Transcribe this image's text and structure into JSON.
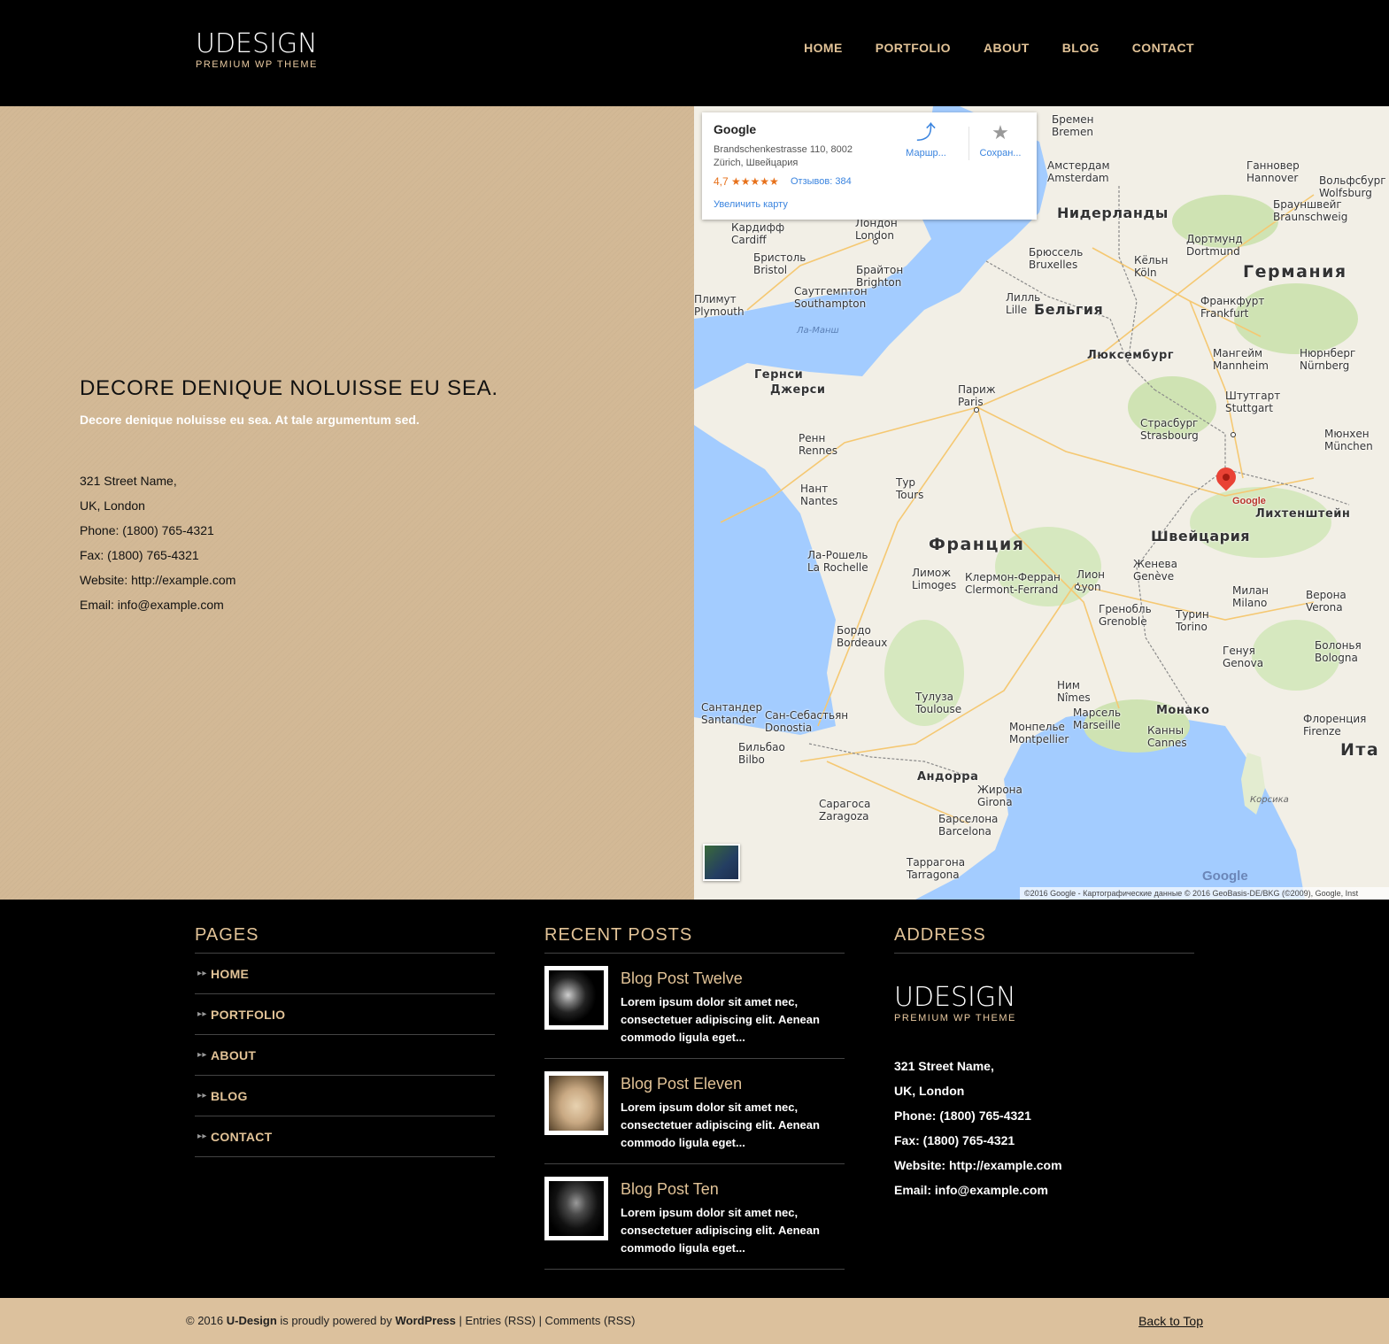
{
  "header": {
    "logo_main": "UDESIGN",
    "logo_sub": "PREMIUM WP THEME",
    "nav": [
      "HOME",
      "PORTFOLIO",
      "ABOUT",
      "BLOG",
      "CONTACT"
    ]
  },
  "contact": {
    "heading": "DECORE DENIQUE NOLUISSE EU SEA.",
    "tagline": "Decore denique noluisse eu sea. At tale argumentum sed.",
    "lines": [
      "321 Street Name,",
      "UK, London",
      "Phone: (1800) 765-4321",
      "Fax: (1800) 765-4321",
      "Website: http://example.com",
      "Email: info@example.com"
    ]
  },
  "map": {
    "card_title": "Google",
    "card_address_1": "Brandschenkestrasse 110, 8002",
    "card_address_2": "Zürich, Швейцария",
    "rating": "4,7 ★★★★★",
    "reviews": "Отзывов: 384",
    "enlarge": "Увеличить карту",
    "directions": "Маршр...",
    "save": "Сохран...",
    "pin_label": "Google",
    "google_logo": "Google",
    "copyright": "©2016 Google - Картографические данные © 2016 GeoBasis-DE/BKG (©2009), Google, Inst",
    "countries": [
      "Германия",
      "Франция",
      "Швейцария",
      "Бельгия",
      "Нидерланды",
      "Ита"
    ],
    "cities": [
      [
        "Бремен",
        "Bremen"
      ],
      [
        "Амстердам",
        "Amsterdam"
      ],
      [
        "Ганновер",
        "Hannover"
      ],
      [
        "Лондон",
        "London"
      ],
      [
        "Кардифф",
        "Cardiff"
      ],
      [
        "Бристоль",
        "Bristol"
      ],
      [
        "Брайтон",
        "Brighton"
      ],
      [
        "Саутгемптон",
        "Southampton"
      ],
      [
        "Плимут",
        "Plymouth"
      ],
      [
        "Брюссель",
        "Bruxelles"
      ],
      [
        "Кёльн",
        "Köln"
      ],
      [
        "Дортмунд",
        "Dortmund"
      ],
      [
        "Лилль",
        "Lille"
      ],
      [
        "Франкфурт",
        "Frankfurt"
      ],
      [
        "Мангейм",
        "Mannheim"
      ],
      [
        "Нюрнберг",
        "Nürnberg"
      ],
      [
        "Париж",
        "Paris"
      ],
      [
        "Штутгарт",
        "Stuttgart"
      ],
      [
        "Страсбург",
        "Strasbourg"
      ],
      [
        "Мюнхен",
        "München"
      ],
      [
        "Ренн",
        "Rennes"
      ],
      [
        "Тур",
        "Tours"
      ],
      [
        "Нант",
        "Nantes"
      ],
      [
        "Ла-Рошель",
        "La Rochelle"
      ],
      [
        "Лимож",
        "Limoges"
      ],
      [
        "Клермон-Ферран",
        "Clermont-Ferrand"
      ],
      [
        "Лион",
        "Lyon"
      ],
      [
        "Женева",
        "Genève"
      ],
      [
        "Милан",
        "Milano"
      ],
      [
        "Верона",
        "Verona"
      ],
      [
        "Гренобль",
        "Grenoble"
      ],
      [
        "Турин",
        "Torino"
      ],
      [
        "Бордо",
        "Bordeaux"
      ],
      [
        "Генуя",
        "Genova"
      ],
      [
        "Болонья",
        "Bologna"
      ],
      [
        "Ним",
        "Nîmes"
      ],
      [
        "Тулуза",
        "Toulouse"
      ],
      [
        "Марсель",
        "Marseille"
      ],
      [
        "Монпелье",
        "Montpellier"
      ],
      [
        "Канны",
        "Cannes"
      ],
      [
        "Флоренция",
        "Firenze"
      ],
      [
        "Сантандер",
        "Santander"
      ],
      [
        "Сан-Себастьян",
        "Donostia"
      ],
      [
        "Бильбао",
        "Bilbo"
      ],
      [
        "Сарагоса",
        "Zaragoza"
      ],
      [
        "Барселона",
        "Barcelona"
      ],
      [
        "Таррагона",
        "Tarragona"
      ],
      [
        "Жирона",
        "Girona"
      ],
      [
        "Брауншвейг",
        "Braunschweig"
      ],
      [
        "Вольфсбург",
        "Wolfsburg"
      ]
    ],
    "regions": [
      "Гернси",
      "Джерси",
      "Андорра",
      "Монако",
      "Лихтенштейн",
      "Люксембург",
      "Корсика"
    ],
    "seas": [
      "Ла-Манш"
    ]
  },
  "footer": {
    "pages_title": "PAGES",
    "pages": [
      "HOME",
      "PORTFOLIO",
      "ABOUT",
      "BLOG",
      "CONTACT"
    ],
    "recent_title": "RECENT POSTS",
    "posts": [
      {
        "title": "Blog Post Twelve",
        "excerpt": "Lorem ipsum dolor sit amet nec, consectetuer adipiscing elit. Aenean commodo ligula eget..."
      },
      {
        "title": "Blog Post Eleven",
        "excerpt": "Lorem ipsum dolor sit amet nec, consectetuer adipiscing elit. Aenean commodo ligula eget..."
      },
      {
        "title": "Blog Post Ten",
        "excerpt": "Lorem ipsum dolor sit amet nec, consectetuer adipiscing elit. Aenean commodo ligula eget..."
      }
    ],
    "address_title": "ADDRESS",
    "address_lines": [
      "321 Street Name,",
      "UK, London",
      "Phone: (1800) 765-4321",
      "Fax: (1800) 765-4321",
      "Website: http://example.com",
      "Email: info@example.com"
    ]
  },
  "bottom": {
    "copy_prefix": "© 2016 ",
    "brand": "U-Design",
    "powered": " is proudly powered by ",
    "wp": "WordPress",
    "rest": " | Entries (RSS) | Comments (RSS)",
    "back_to_top": "Back to Top"
  }
}
